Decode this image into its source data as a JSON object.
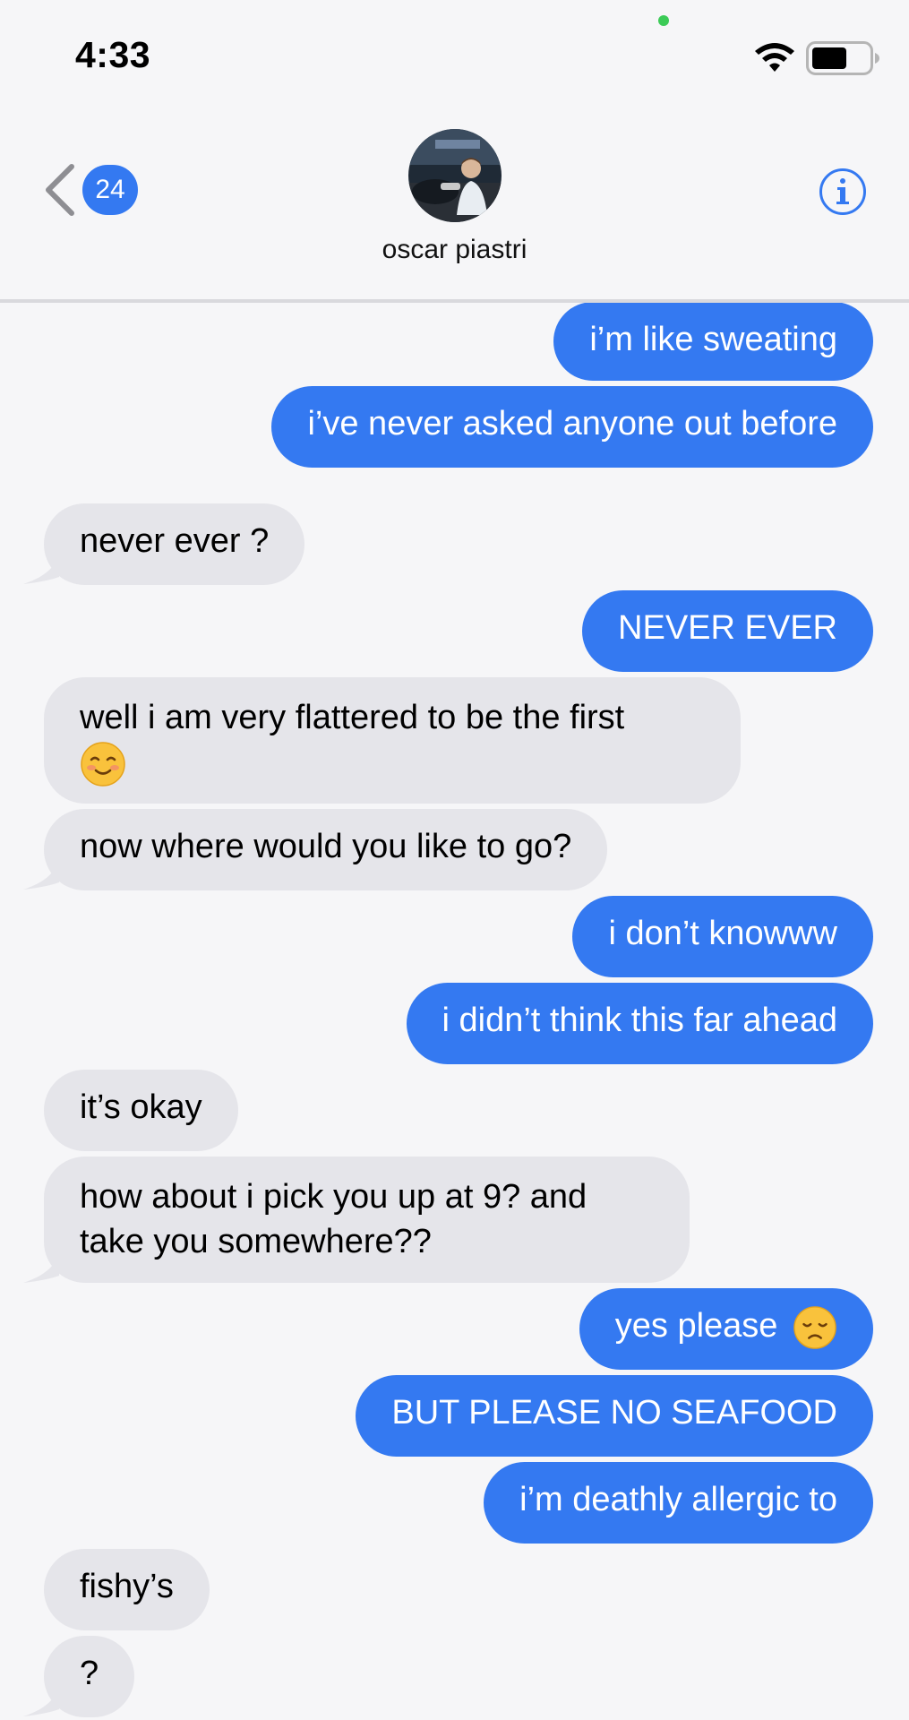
{
  "status": {
    "time": "4:33"
  },
  "header": {
    "back_count": "24",
    "contact_name": "oscar piastri"
  },
  "messages": [
    {
      "dir": "sent",
      "text": "i’m like sweating"
    },
    {
      "dir": "sent",
      "text": "i’ve never asked anyone out before"
    },
    {
      "dir": "recv",
      "text": "never ever ?"
    },
    {
      "dir": "sent",
      "text": "NEVER EVER"
    },
    {
      "dir": "recv",
      "text": "well i am very flattered to be the first",
      "emoji": "smiling-blushing-emoji"
    },
    {
      "dir": "recv",
      "text": "now where would you like to go?"
    },
    {
      "dir": "sent",
      "text": "i don’t knowww"
    },
    {
      "dir": "sent",
      "text": "i didn’t think this far ahead"
    },
    {
      "dir": "recv",
      "text": "it’s okay"
    },
    {
      "dir": "recv",
      "text": "how about i pick you up at 9? and take you somewhere??"
    },
    {
      "dir": "sent",
      "text": "yes please",
      "emoji": "disappointed-face-emoji"
    },
    {
      "dir": "sent",
      "text": "BUT PLEASE NO SEAFOOD"
    },
    {
      "dir": "sent",
      "text": "i’m deathly allergic to"
    },
    {
      "dir": "recv",
      "text": "fishy’s"
    },
    {
      "dir": "recv",
      "text": "?"
    }
  ],
  "colors": {
    "sent_bubble": "#3479f1",
    "recv_bubble": "#e5e5ea",
    "background": "#f6f6f8",
    "accent": "#3479f1"
  }
}
